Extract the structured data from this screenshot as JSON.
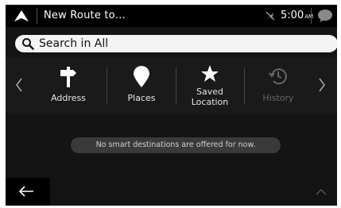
{
  "topbar": {
    "title": "New Route to…",
    "nav_icon": "navigation-arrow-icon",
    "gps_icon": "gps-off-icon",
    "time": "5:00",
    "ampm": "AM",
    "message_icon": "message-bubble-icon"
  },
  "search": {
    "label": "Search in All",
    "icon": "search-icon"
  },
  "menu": {
    "items": [
      {
        "label": "Address",
        "icon": "signpost-icon",
        "enabled": true
      },
      {
        "label": "Places",
        "icon": "map-pin-icon",
        "enabled": true
      },
      {
        "label": "Saved\nLocation",
        "icon": "star-icon",
        "enabled": true
      },
      {
        "label": "History",
        "icon": "history-icon",
        "enabled": false
      }
    ],
    "prev_icon": "chevron-left-icon",
    "next_icon": "chevron-right-icon"
  },
  "notice": "No smart destinations are offered for now.",
  "bottombar": {
    "back_icon": "back-arrow-icon",
    "up_icon": "chevron-up-icon"
  },
  "colors": {
    "background": "#141414",
    "topbar": "#000000",
    "search_bg": "#f4f4f4",
    "text": "#ffffff",
    "disabled": "#666666"
  }
}
